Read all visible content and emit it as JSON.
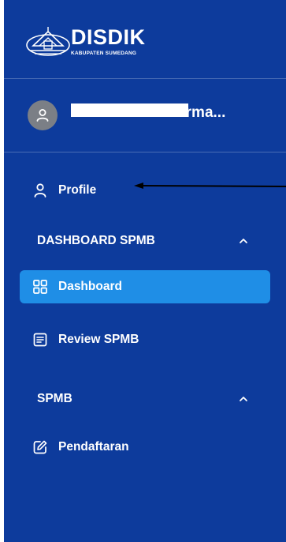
{
  "brand": {
    "title": "DISDIK",
    "subtitle": "KABUPATEN SUMEDANG"
  },
  "user": {
    "name": "Alika Ghania Herma..."
  },
  "nav": {
    "profile_label": "Profile",
    "sections": [
      {
        "title": "DASHBOARD SPMB",
        "items": [
          {
            "label": "Dashboard",
            "icon": "dashboard-grid-icon",
            "active": true
          },
          {
            "label": "Review SPMB",
            "icon": "review-list-icon",
            "active": false
          }
        ]
      },
      {
        "title": "SPMB",
        "items": [
          {
            "label": "Pendaftaran",
            "icon": "edit-square-icon",
            "active": false
          }
        ]
      }
    ]
  },
  "colors": {
    "sidebar_bg": "#0d3b9c",
    "active_bg": "#1f8ee6",
    "text": "#ffffff",
    "avatar_bg": "#7b7f86"
  }
}
